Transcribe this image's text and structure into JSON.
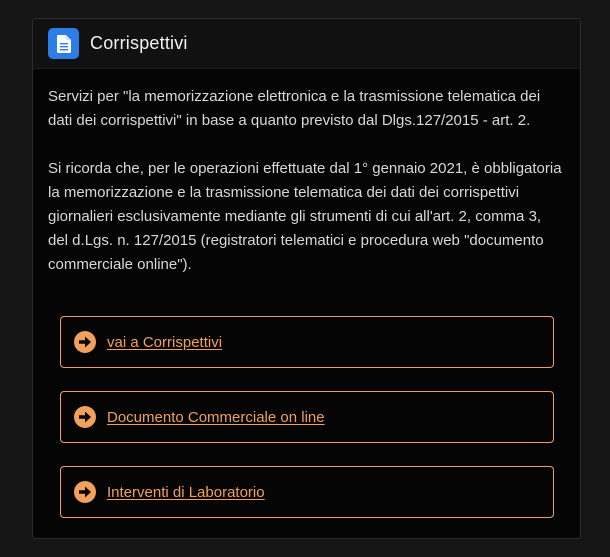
{
  "panel": {
    "title": "Corrispettivi",
    "icon": "document-icon",
    "paragraphs": [
      "Servizi per \"la memorizzazione elettronica e la trasmissione telematica dei dati dei corrispettivi\" in base a quanto previsto dal Dlgs.127/2015 - art. 2.",
      "Si ricorda che, per le operazioni effettuate dal 1° gennaio 2021, è obbligatoria la memorizzazione e la trasmissione telematica dei dati dei corrispettivi giornalieri esclusivamente mediante gli strumenti di cui all'art. 2, comma 3, del d.Lgs. n. 127/2015 (registratori telematici e procedura web \"documento commerciale online\")."
    ]
  },
  "links": [
    {
      "label": "vai a Corrispettivi",
      "icon": "arrow-right-circle-icon"
    },
    {
      "label": "Documento Commerciale on line",
      "icon": "arrow-right-circle-icon"
    },
    {
      "label": "Interventi di Laboratorio",
      "icon": "arrow-right-circle-icon"
    }
  ],
  "colors": {
    "accent": "#f2a05c",
    "icon_bg": "#2a7ee6",
    "background": "#050505"
  }
}
